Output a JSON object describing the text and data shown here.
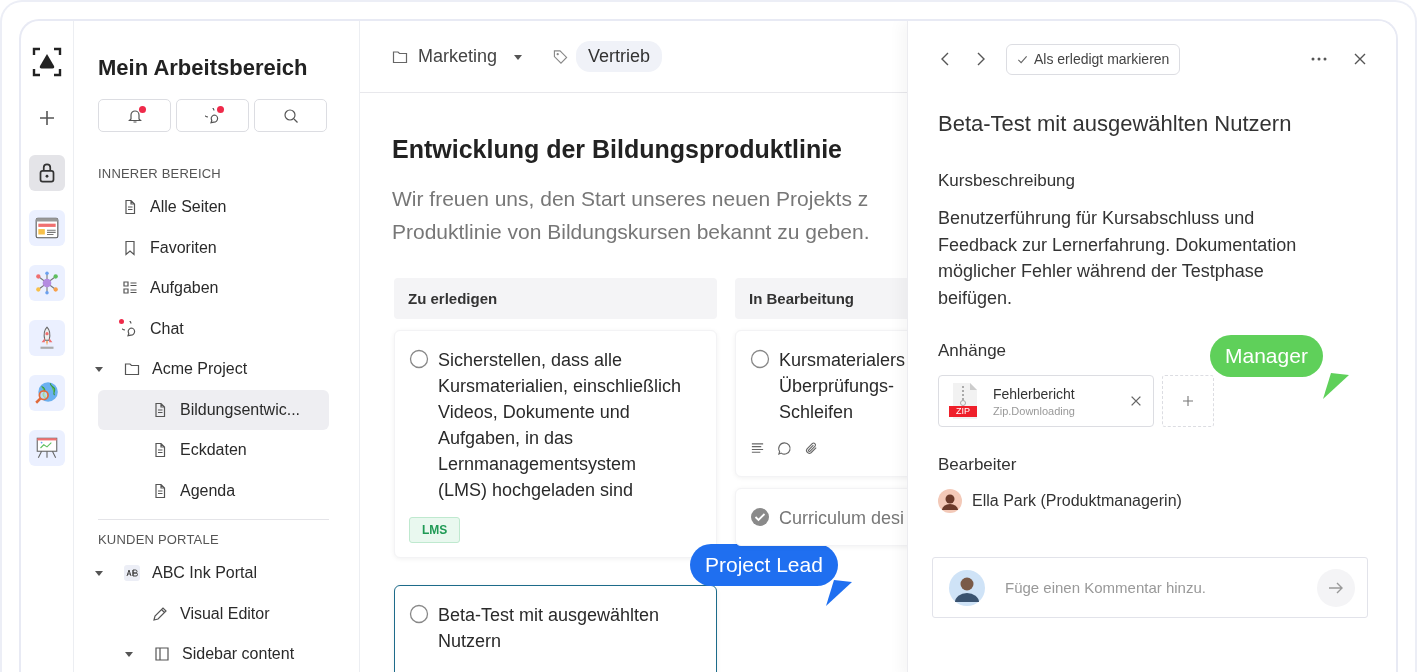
{
  "rail": [
    {
      "kind": "lock",
      "selected": true
    },
    {
      "kind": "browser",
      "selected": false
    },
    {
      "kind": "network",
      "selected": false
    },
    {
      "kind": "rocket",
      "selected": false
    },
    {
      "kind": "globe",
      "selected": false
    },
    {
      "kind": "board",
      "selected": false
    }
  ],
  "sidebar": {
    "title": "Mein Arbeitsbereich",
    "buttons": [
      {
        "kind": "bell",
        "badge": true
      },
      {
        "kind": "chat",
        "badge": true
      },
      {
        "kind": "search",
        "badge": false
      }
    ],
    "sections": [
      {
        "heading": "INNERER BEREICH",
        "items": [
          {
            "label": "Alle Seiten",
            "kind": "page",
            "selected": false,
            "badge": false
          },
          {
            "label": "Favoriten",
            "kind": "bookmark",
            "selected": false,
            "badge": false
          },
          {
            "label": "Aufgaben",
            "kind": "tasks",
            "selected": false,
            "badge": false
          },
          {
            "label": "Chat",
            "kind": "chat",
            "selected": false,
            "badge": true
          },
          {
            "label": "Acme Project",
            "kind": "folder",
            "selected": false,
            "badge": false,
            "expanded": true,
            "children": [
              {
                "label": "Bildungsentwic...",
                "kind": "page",
                "selected": true,
                "badge": false
              },
              {
                "label": "Eckdaten",
                "kind": "page",
                "selected": false,
                "badge": false
              },
              {
                "label": "Agenda",
                "kind": "page",
                "selected": false,
                "badge": false
              }
            ]
          }
        ]
      },
      {
        "heading": "KUNDEN PORTALE",
        "items": [
          {
            "label": "ABC Ink Portal",
            "kind": "ab",
            "selected": false,
            "badge": false,
            "expanded": true,
            "children": [
              {
                "label": "Visual Editor",
                "kind": "pencil",
                "selected": false,
                "badge": false
              },
              {
                "label": "Sidebar content",
                "kind": "sidebar",
                "selected": false,
                "badge": false,
                "expanded": true
              }
            ]
          }
        ]
      }
    ]
  },
  "main": {
    "folder": "Marketing",
    "tag": "Vertrieb",
    "title": "Entwicklung der Bildungsproduktlinie",
    "intro": [
      "Wir freuen uns, den Start unseres neuen Projekts z",
      "Produktlinie von Bildungskursen bekannt zu geben."
    ],
    "columns": [
      {
        "title": "Zu erledigen",
        "cards": [
          {
            "lines": [
              "Sicherstellen, dass alle",
              "Kursmaterialien, einschließlich",
              "Videos, Dokumente und",
              "Aufgaben, in das",
              "Lernmanagementsystem",
              "(LMS) hochgeladen sind"
            ],
            "done": false,
            "selected": false,
            "tag": "LMS",
            "meta": false
          },
          {
            "lines": [
              "Beta-Test mit ausgewählten",
              "Nutzern"
            ],
            "done": false,
            "selected": true,
            "meta": false
          }
        ]
      },
      {
        "title": "In Bearbeitung",
        "cards": [
          {
            "lines": [
              "Kursmaterialers",
              "Überprüfungs-",
              "Schleifen"
            ],
            "done": false,
            "selected": false,
            "meta": true
          },
          {
            "lines": [
              "Curriculum desi"
            ],
            "done": true,
            "selected": false,
            "meta": false
          }
        ]
      }
    ]
  },
  "panel": {
    "done_button": "Als erledigt markieren",
    "title": "Beta-Test mit ausgewählten Nutzern",
    "description_heading": "Kursbeschreibung",
    "description": "Benutzerführung für Kursabschluss und Feedback zur Lernerfahrung. Dokumentation möglicher Fehler während der Testphase beifügen.",
    "attachments_heading": "Anhänge",
    "attachments": [
      {
        "name": "Fehlerbericht",
        "status": "Zip.Downloading",
        "type": "ZIP"
      }
    ],
    "assignee_heading": "Bearbeiter",
    "assignee": "Ella Park (Produktmanagerin)",
    "comment": {
      "placeholder": "Füge einen Kommentar hinzu."
    }
  },
  "tooltips": [
    {
      "label": "Project Lead",
      "color": "#1f6ff0"
    },
    {
      "label": "Manager",
      "color": "#5fd05a"
    }
  ]
}
